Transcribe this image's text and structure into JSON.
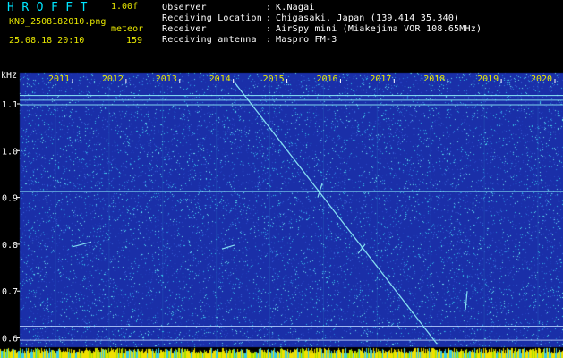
{
  "app": {
    "title": "HROFFT",
    "version": "1.00f",
    "filename": "KN9_2508182010.png",
    "mode": "meteor",
    "datetime": "25.08.18 20:10",
    "count": "159"
  },
  "info": {
    "labels": [
      "Observer",
      "Receiving Location",
      "Receiver",
      "Receiving antenna"
    ],
    "colons": [
      ":",
      ":",
      ":",
      ":"
    ],
    "values": [
      "K.Nagai",
      "Chigasaki, Japan (139.414 35.340)",
      "AirSpy mini (Miakejima VOR 108.65MHz)",
      "Maspro FM-3"
    ]
  },
  "spectrogram": {
    "y_unit": "kHz",
    "y_ticks": [
      "1.1",
      "1.0",
      "0.9",
      "0.8",
      "0.7",
      "0.6"
    ],
    "y_tick_values": [
      1.1,
      1.0,
      0.9,
      0.8,
      0.7,
      0.6
    ],
    "y_range": [
      0.58,
      1.165
    ],
    "time_labels": [
      "2011",
      "2012",
      "2013",
      "2014",
      "2015",
      "2016",
      "2017",
      "2018",
      "2019",
      "2020"
    ],
    "colors": {
      "background": "#1a2fa8",
      "noise": "#36c8e8",
      "trace": "#8ff0f8",
      "grid": "#c0d8ff",
      "text": "#ffffff",
      "accent": "#e8e800",
      "title": "#00e5ff"
    }
  }
}
